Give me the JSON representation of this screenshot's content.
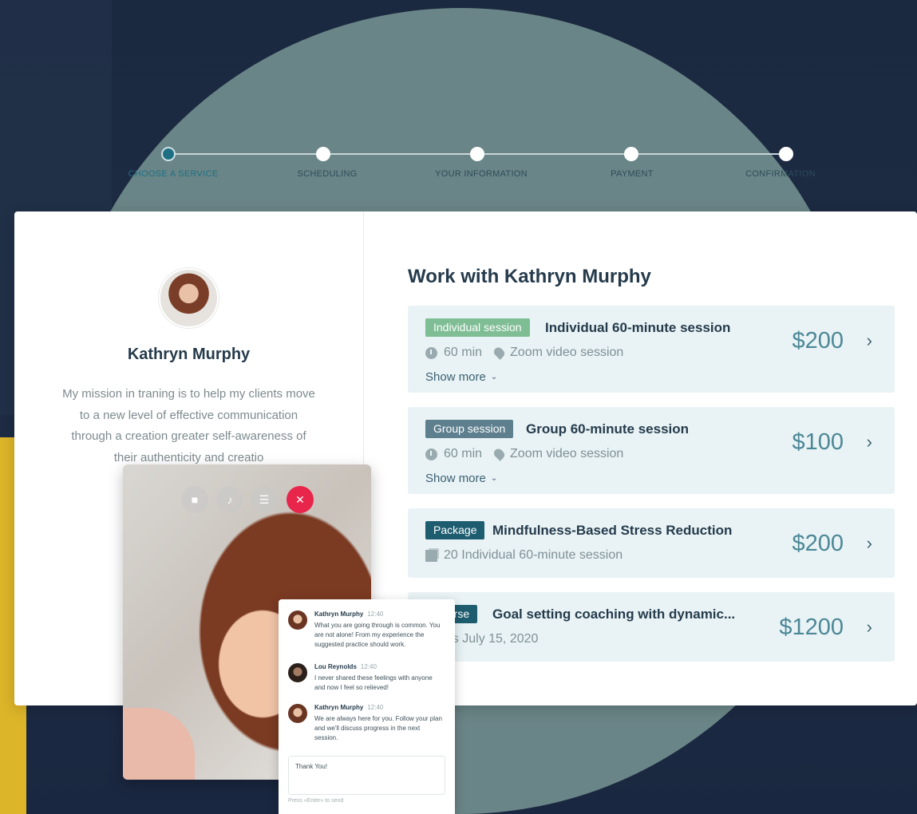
{
  "stepper": {
    "steps": [
      {
        "label": "CHOOSE A SERVICE",
        "active": true
      },
      {
        "label": "SCHEDULING",
        "active": false
      },
      {
        "label": "YOUR INFORMATION",
        "active": false
      },
      {
        "label": "PAYMENT",
        "active": false
      },
      {
        "label": "CONFIRMATION",
        "active": false
      }
    ]
  },
  "coach": {
    "name": "Kathryn Murphy",
    "bio": "My mission in traning is to help my clients move to a new level of effective communication through a creation greater self-awareness of their authenticity and creatio"
  },
  "main": {
    "title": "Work with Kathryn Murphy",
    "services": [
      {
        "tag": "Individual session",
        "tag_color": "#7fbd95",
        "title": "Individual 60-minute session",
        "duration": "60 min",
        "location": "Zoom video session",
        "show_more": "Show more",
        "price": "$200",
        "icons": [
          "clock-icon",
          "pin-icon",
          "chevron-down-icon",
          "chevron-right-icon"
        ]
      },
      {
        "tag": "Group session",
        "tag_color": "#5d7f8e",
        "title": "Group 60-minute session",
        "duration": "60 min",
        "location": "Zoom video session",
        "show_more": "Show more",
        "price": "$100",
        "icons": [
          "clock-icon",
          "pin-icon",
          "chevron-down-icon",
          "chevron-right-icon"
        ]
      },
      {
        "tag": "Package",
        "tag_color": "#1e5d70",
        "title": "Mindfulness-Based Stress Reduction",
        "detail": "20 Individual 60-minute session",
        "price": "$200",
        "icons": [
          "stack-icon",
          "chevron-right-icon"
        ]
      },
      {
        "tag": "Course",
        "tag_color": "#1e5d70",
        "title": "Goal setting coaching with dynamic...",
        "detail": "Starts July 15, 2020",
        "price": "$1200",
        "icons": [
          "chevron-right-icon"
        ]
      }
    ]
  },
  "video_call": {
    "controls": [
      "camera-icon",
      "speaker-icon",
      "chat-icon",
      "end-call-icon"
    ]
  },
  "chat": {
    "messages": [
      {
        "author": "Kathryn Murphy",
        "time": "12:40",
        "text": "What you are going through is common. You are not alone! From my experience the suggested practice should work."
      },
      {
        "author": "Lou Reynolds",
        "time": "12:40",
        "text": "I never shared these feelings with anyone and now I feel so relieved!"
      },
      {
        "author": "Kathryn Murphy",
        "time": "12:40",
        "text": "We are always here for you. Follow your plan and we'll discuss progress in the next session."
      }
    ],
    "input_value": "Thank You!",
    "hint": "Press «Enter» to send"
  },
  "colors": {
    "background": "#1c2a40",
    "circle": "#6a8587",
    "accent": "#1e6f84",
    "price": "#4b8796",
    "yellow": "#ddb529",
    "end_call": "#e8254a"
  }
}
